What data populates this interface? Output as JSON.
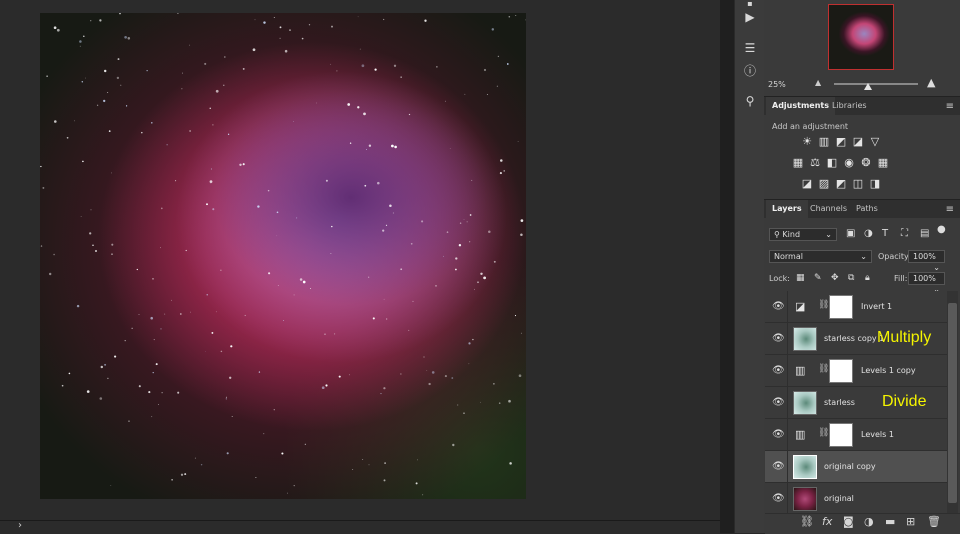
{
  "navigator": {
    "zoom": "25%"
  },
  "adjustments_panel": {
    "tabs": [
      "Adjustments",
      "Libraries"
    ],
    "hint": "Add an adjustment",
    "rows": [
      [
        "☀",
        "▥",
        "◩",
        "◪",
        "▽"
      ],
      [
        "▦",
        "⚖",
        "◧",
        "◉",
        "❂",
        "▦"
      ],
      [
        "◪",
        "▨",
        "◩",
        "◫",
        "◨"
      ]
    ]
  },
  "layers_panel": {
    "tabs": [
      "Layers",
      "Channels",
      "Paths"
    ],
    "filter_kind": "Kind",
    "blend_mode": "Normal",
    "opacity_label": "Opacity:",
    "opacity_value": "100%",
    "lock_label": "Lock:",
    "fill_label": "Fill:",
    "fill_value": "100%",
    "layers": [
      {
        "name": "Invert 1",
        "kind": "adjustment",
        "glyph": "◪",
        "annotation": "",
        "selected": false
      },
      {
        "name": "starless copy 1",
        "kind": "image",
        "thumb": "teal",
        "annotation": "Multiply",
        "selected": false
      },
      {
        "name": "Levels 1 copy",
        "kind": "adjustment",
        "glyph": "▥",
        "annotation": "",
        "selected": false
      },
      {
        "name": "starless",
        "kind": "image",
        "thumb": "teal",
        "annotation": "Divide",
        "selected": false
      },
      {
        "name": "Levels 1",
        "kind": "adjustment",
        "glyph": "▥",
        "annotation": "",
        "selected": false
      },
      {
        "name": "original copy",
        "kind": "image",
        "thumb": "teal",
        "annotation": "",
        "selected": true
      },
      {
        "name": "original",
        "kind": "image",
        "thumb": "red",
        "annotation": "",
        "selected": false
      }
    ]
  },
  "colors": {
    "panel_bg": "#3a3a3a",
    "annotation": "#f5f500",
    "nav_frame": "#c03030"
  },
  "icons": {
    "tools": [
      "play-icon",
      "sliders-icon",
      "info-icon",
      "stamp-icon"
    ],
    "footer": [
      "link-icon",
      "fx-icon",
      "mask-icon",
      "adjustment-icon",
      "folder-icon",
      "new-layer-icon",
      "trash-icon"
    ]
  }
}
